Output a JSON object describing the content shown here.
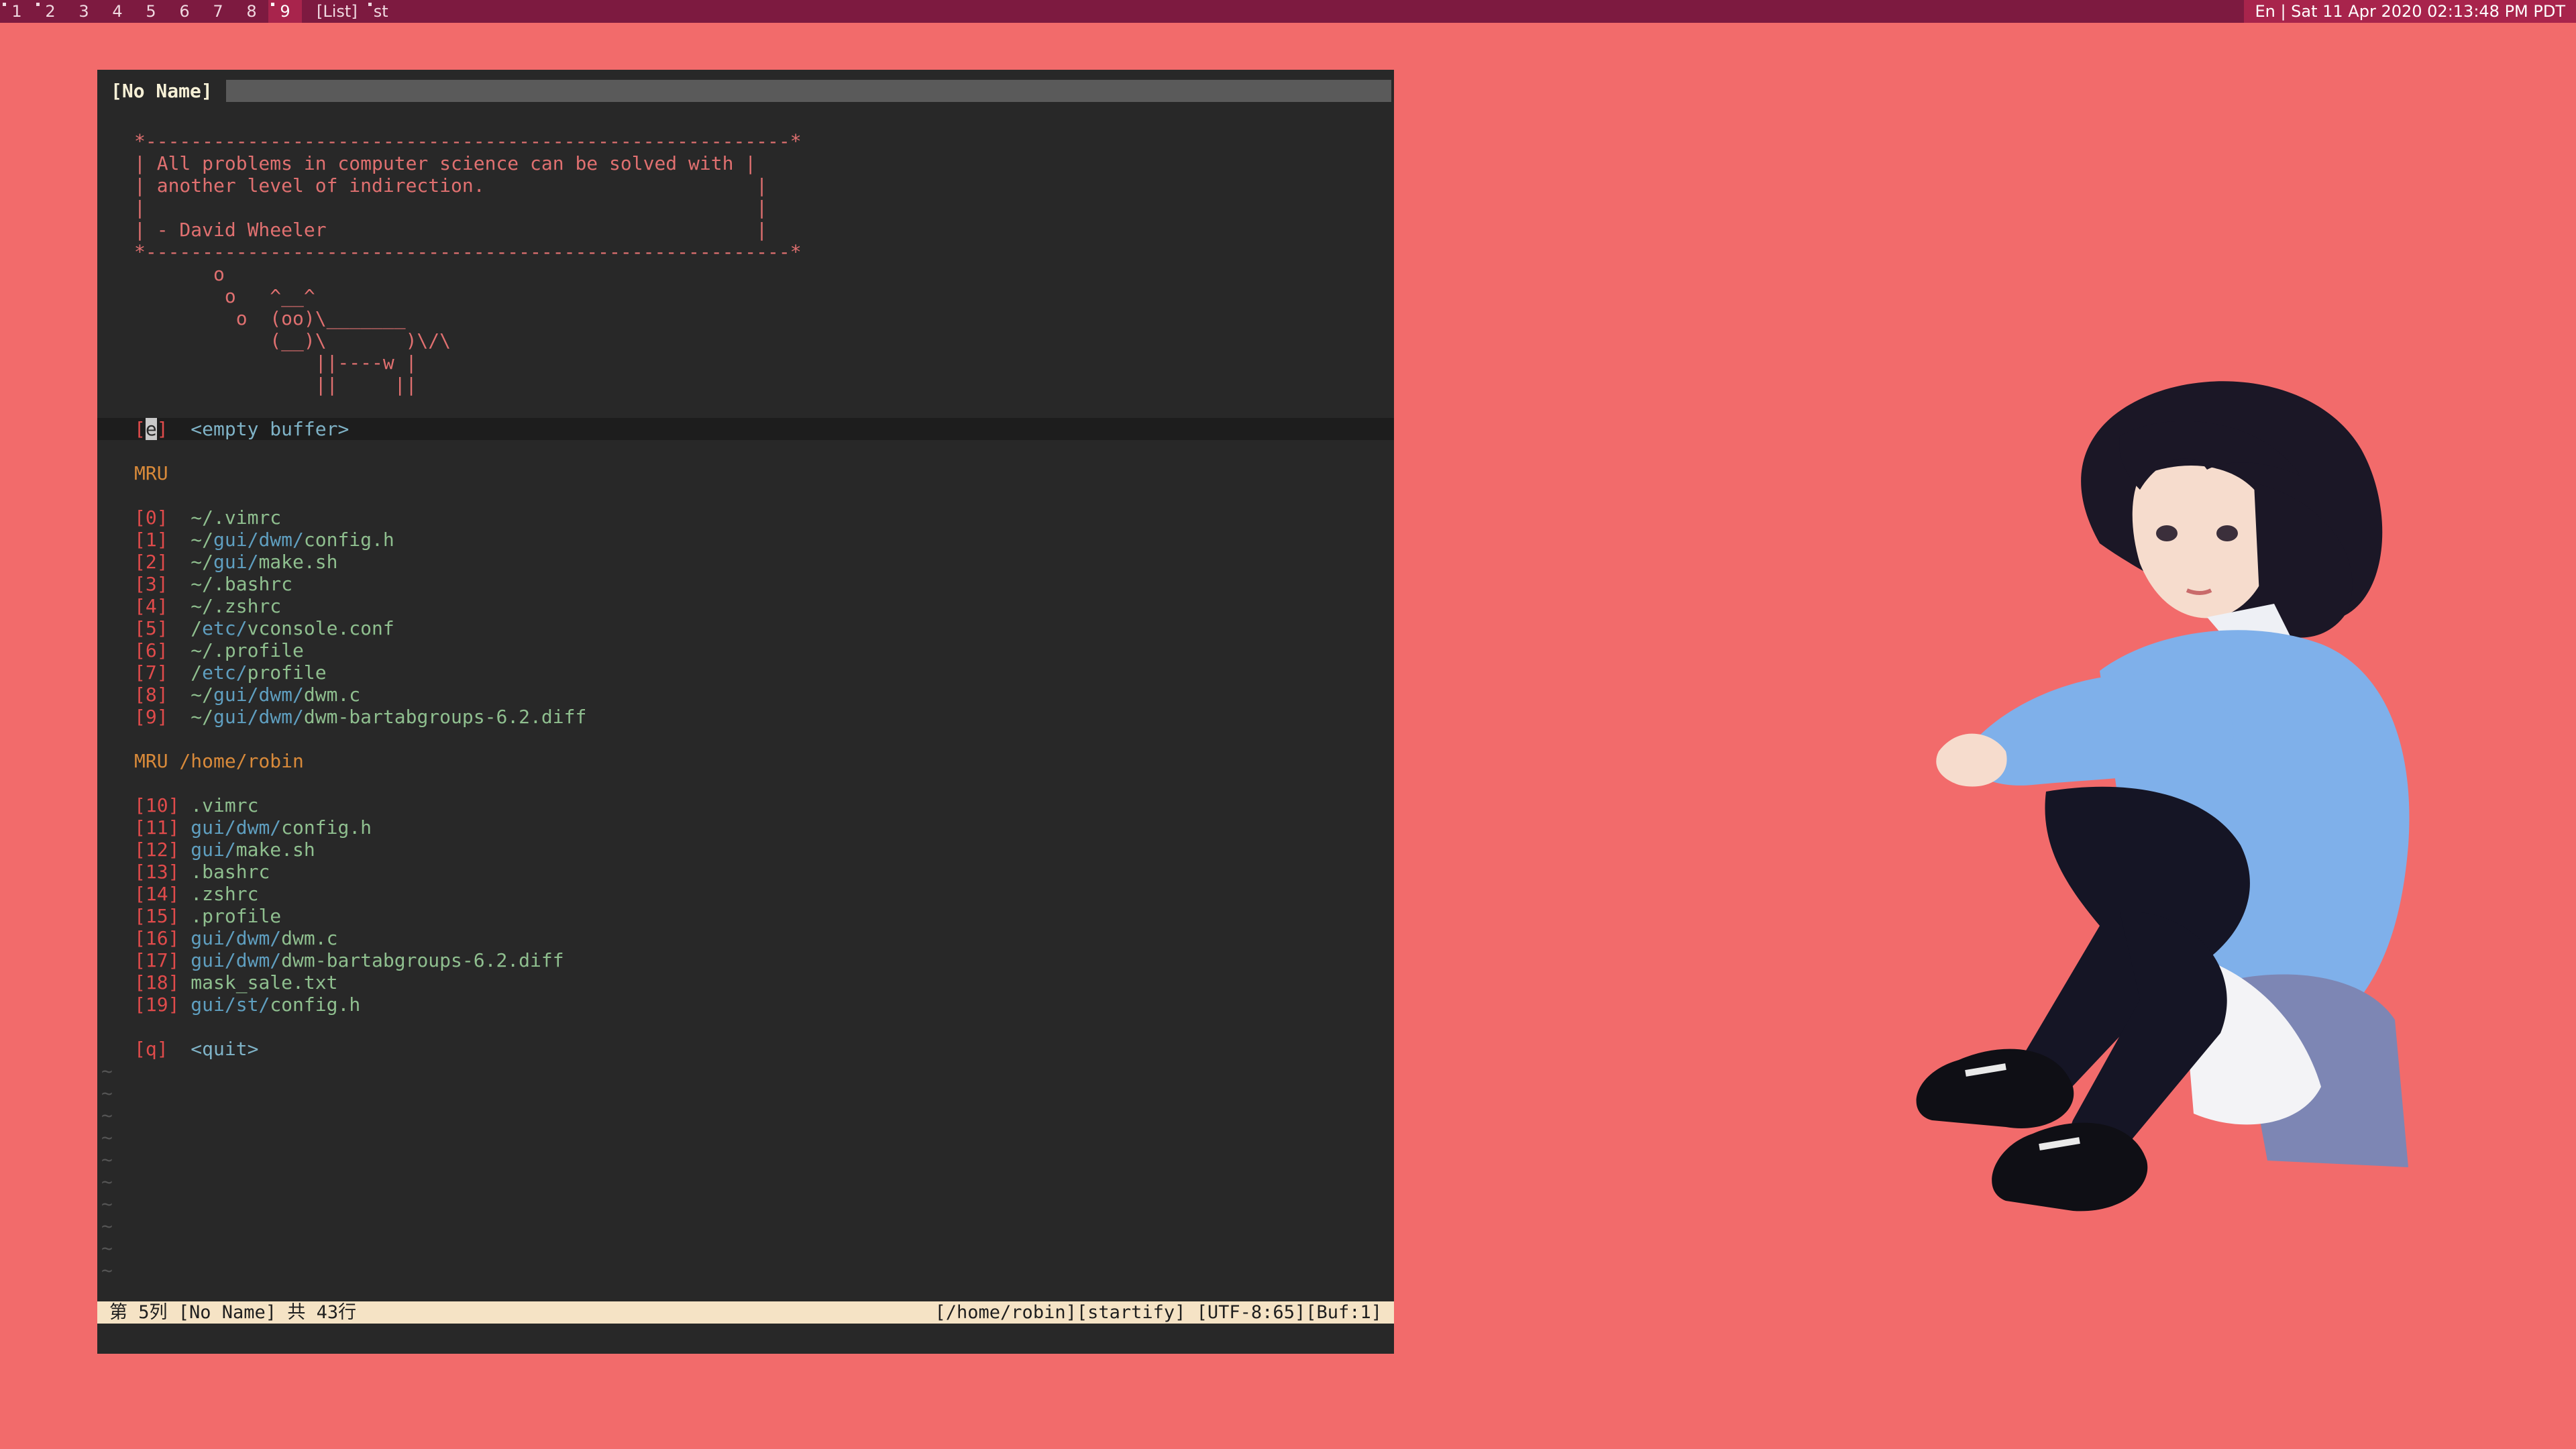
{
  "topbar": {
    "tags": [
      "1",
      "2",
      "3",
      "4",
      "5",
      "6",
      "7",
      "8",
      "9"
    ],
    "selected_tag": "9",
    "layout": "[List]",
    "window_title": "st",
    "status": "En | Sat 11 Apr 2020 02:13:48 PM PDT"
  },
  "vim": {
    "tab_label": "[No Name]",
    "quote_lines": [
      "*---------------------------------------------------------*",
      "| All problems in computer science can be solved with |",
      "| another level of indirection.                        |",
      "|                                                      |",
      "| - David Wheeler                                      |",
      "*---------------------------------------------------------*"
    ],
    "cow_lines": [
      "       o",
      "        o   ^__^",
      "         o  (oo)\\_______",
      "            (__)\\       )\\/\\",
      "                ||----w |",
      "                ||     ||"
    ],
    "empty_buffer": {
      "key": "e",
      "label": "<empty buffer>"
    },
    "mru_title": "MRU",
    "mru": [
      {
        "key": "0",
        "prefix": "~/",
        "dir": "",
        "file": ".vimrc"
      },
      {
        "key": "1",
        "prefix": "~/",
        "dir": "gui/dwm/",
        "file": "config.h"
      },
      {
        "key": "2",
        "prefix": "~/",
        "dir": "gui/",
        "file": "make.sh"
      },
      {
        "key": "3",
        "prefix": "~/",
        "dir": "",
        "file": ".bashrc"
      },
      {
        "key": "4",
        "prefix": "~/",
        "dir": "",
        "file": ".zshrc"
      },
      {
        "key": "5",
        "prefix": "/",
        "dir": "etc/",
        "file": "vconsole.conf"
      },
      {
        "key": "6",
        "prefix": "~/",
        "dir": "",
        "file": ".profile"
      },
      {
        "key": "7",
        "prefix": "/",
        "dir": "etc/",
        "file": "profile"
      },
      {
        "key": "8",
        "prefix": "~/",
        "dir": "gui/dwm/",
        "file": "dwm.c"
      },
      {
        "key": "9",
        "prefix": "~/",
        "dir": "gui/dwm/",
        "file": "dwm-bartabgroups-6.2.diff"
      }
    ],
    "mru_dir_title": "MRU /home/robin",
    "mru_dir": [
      {
        "key": "10",
        "dir": "",
        "file": ".vimrc"
      },
      {
        "key": "11",
        "dir": "gui/dwm/",
        "file": "config.h"
      },
      {
        "key": "12",
        "dir": "gui/",
        "file": "make.sh"
      },
      {
        "key": "13",
        "dir": "",
        "file": ".bashrc"
      },
      {
        "key": "14",
        "dir": "",
        "file": ".zshrc"
      },
      {
        "key": "15",
        "dir": "",
        "file": ".profile"
      },
      {
        "key": "16",
        "dir": "gui/dwm/",
        "file": "dwm.c"
      },
      {
        "key": "17",
        "dir": "gui/dwm/",
        "file": "dwm-bartabgroups-6.2.diff"
      },
      {
        "key": "18",
        "dir": "",
        "file": "mask_sale.txt"
      },
      {
        "key": "19",
        "dir": "gui/st/",
        "file": "config.h"
      }
    ],
    "quit": {
      "key": "q",
      "label": "<quit>"
    },
    "tilde": "~",
    "statusline": {
      "left": "第 5列  [No Name]  共 43行",
      "right": "[/home/robin][startify] [UTF-8:65][Buf:1]"
    }
  },
  "colors": {
    "wallpaper": "#f26b6b",
    "bar": "#7d1a40",
    "bar_selected": "#a8244c",
    "terminal_bg": "#282828"
  }
}
